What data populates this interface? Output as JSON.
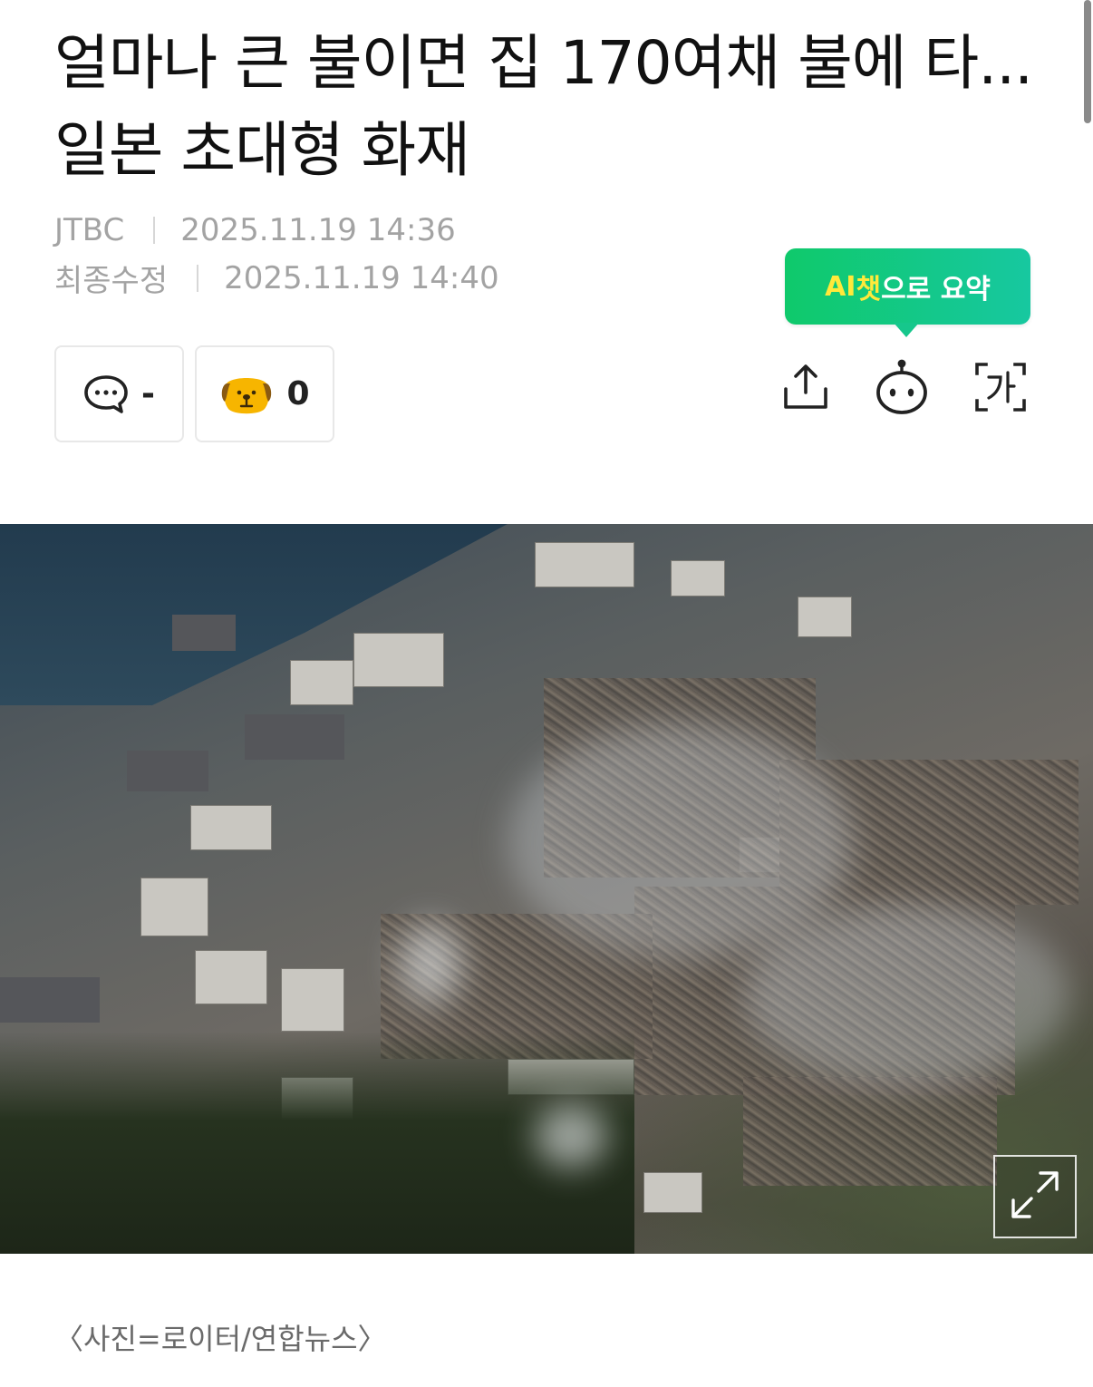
{
  "article": {
    "title": "얼마나 큰 불이면 집 170여채 불에 타...일본 초대형 화재",
    "press": "JTBC",
    "published": "2025.11.19 14:36",
    "modified_label": "최종수정",
    "modified": "2025.11.19 14:40"
  },
  "actions": {
    "comment_count": "-",
    "reaction_count": "0"
  },
  "ai_summary": {
    "part_ai": "AI",
    "part_chat": "챗",
    "part_rest": "으로 요약"
  },
  "photo": {
    "caption": "〈사진=로이터/연합뉴스〉"
  },
  "colors": {
    "accent_green": "#0fc96b",
    "accent_teal": "#17c8a0",
    "highlight_yellow": "#ffe93a",
    "meta_gray": "#a3a3a3",
    "reaction_yellow": "#f7b500"
  },
  "icons": {
    "comment": "speech-bubble-icon",
    "reaction": "dog-face-icon",
    "share": "share-icon",
    "ai_bot": "robot-face-icon",
    "font_size": "font-size-icon",
    "expand": "expand-arrows-icon"
  }
}
